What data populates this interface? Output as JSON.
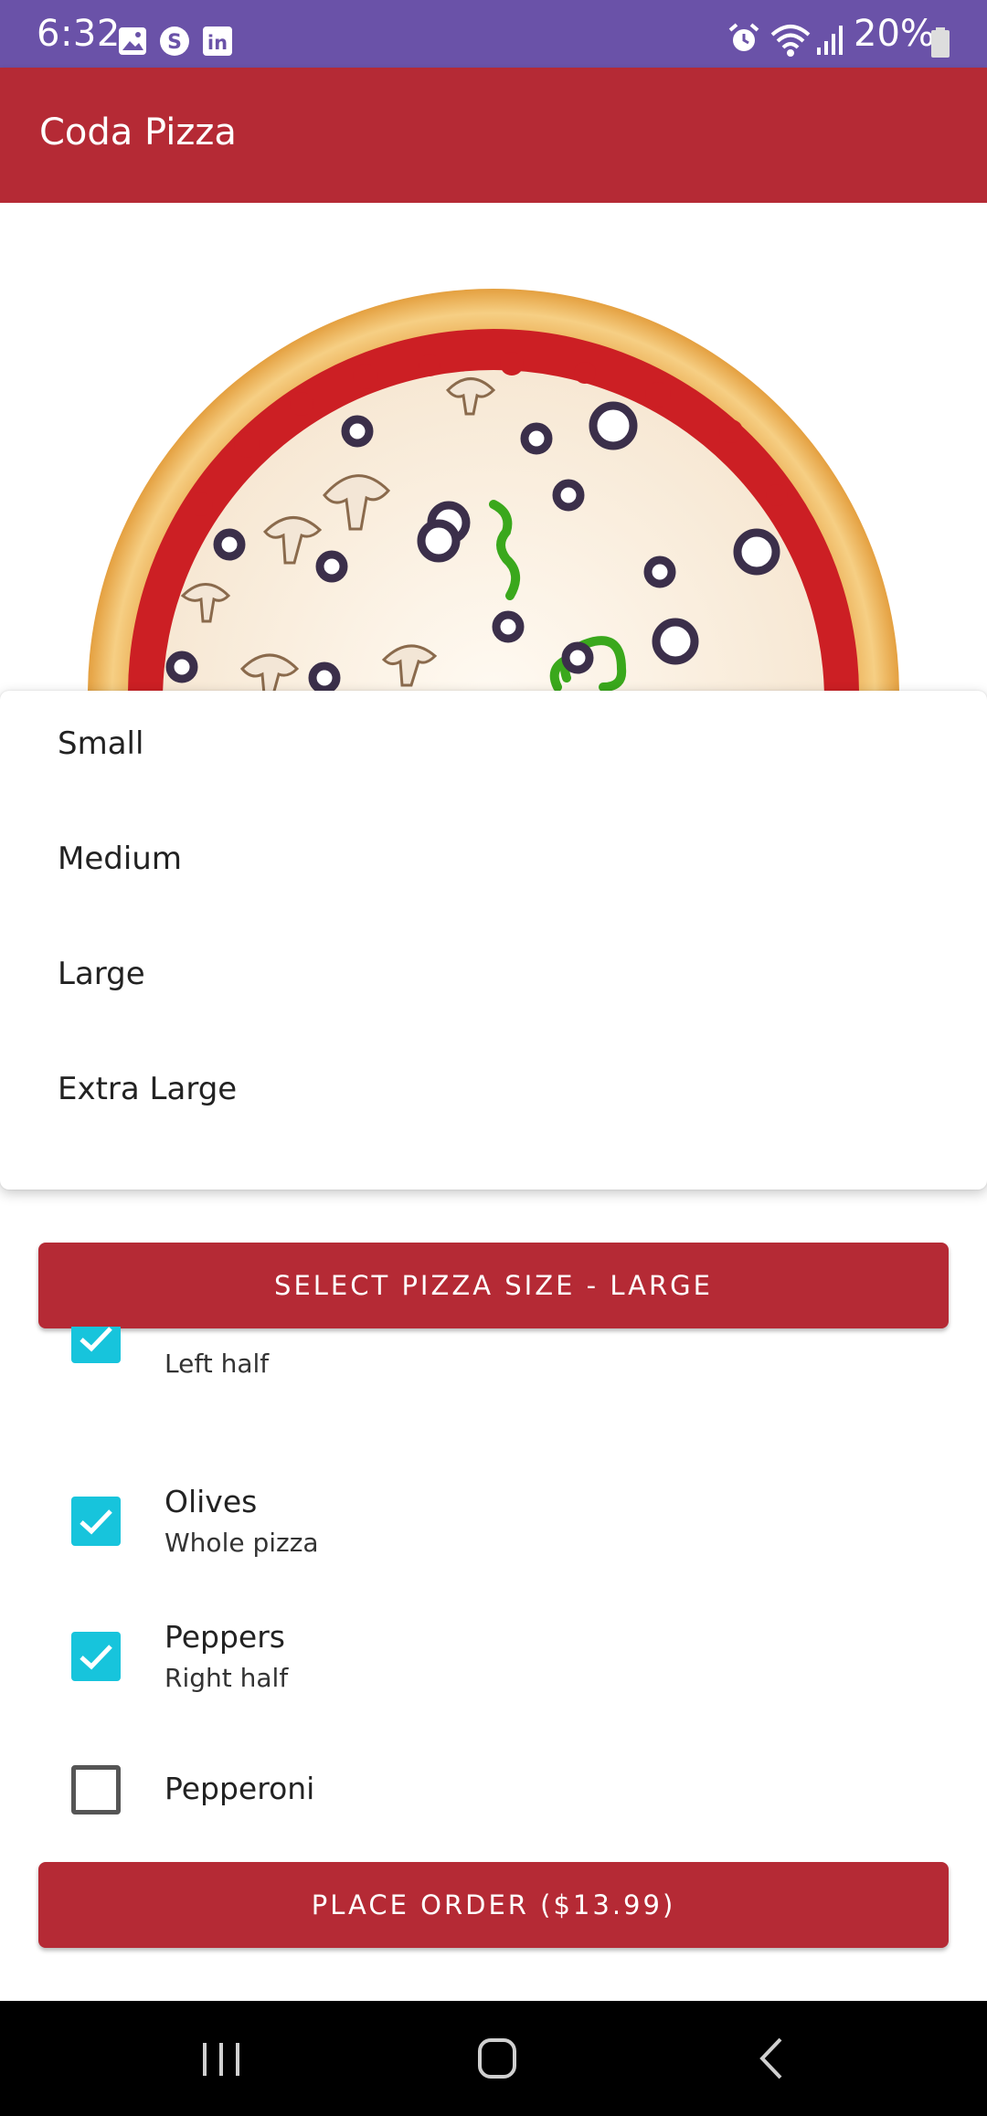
{
  "status_bar": {
    "time": "6:32",
    "battery": "20%",
    "left_icons": [
      "image-icon",
      "s-circle-icon",
      "linkedin-icon"
    ],
    "right_icons": [
      "alarm-icon",
      "wifi-icon",
      "signal-icon",
      "battery-icon"
    ]
  },
  "app_bar": {
    "title": "Coda Pizza"
  },
  "size_menu": {
    "options": [
      "Small",
      "Medium",
      "Large",
      "Extra Large"
    ]
  },
  "size_button": {
    "label": "SELECT PIZZA SIZE - LARGE"
  },
  "toppings": [
    {
      "name": "",
      "placement": "Left half",
      "checked": true
    },
    {
      "name": "Olives",
      "placement": "Whole pizza",
      "checked": true
    },
    {
      "name": "Peppers",
      "placement": "Right half",
      "checked": true
    },
    {
      "name": "Pepperoni",
      "placement": "",
      "checked": false
    }
  ],
  "order_button": {
    "label": "PLACE ORDER ($13.99)"
  },
  "colors": {
    "status_bar": "#6a52a8",
    "accent": "#b52a35",
    "checkbox": "#17c4dc"
  },
  "nav_bar": {
    "icons": [
      "recents-icon",
      "home-icon",
      "back-icon"
    ]
  }
}
